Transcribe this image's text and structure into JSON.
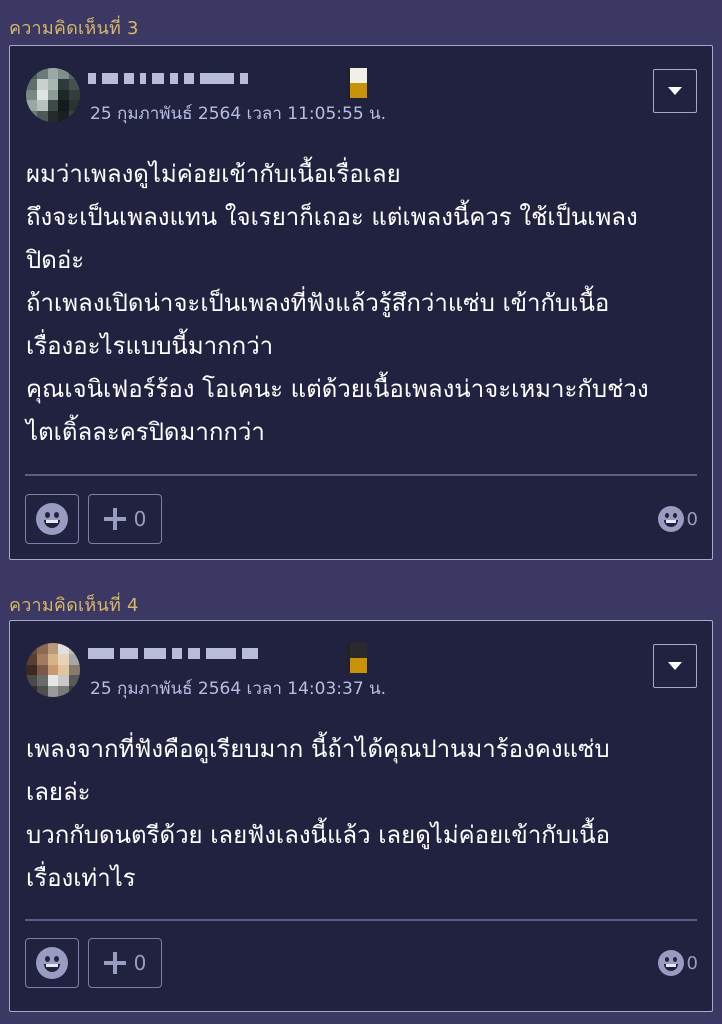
{
  "comments": [
    {
      "label": "ความคิดเห็นที่ 3",
      "timestamp": "25 กุมภาพันธ์ 2564 เวลา 11:05:55 น.",
      "body": "ผมว่าเพลงดูไม่ค่อยเข้ากับเนื้อเรื่อเลย\nถึงจะเป็นเพลงแทน ใจเรยาก็เถอะ แต่เพลงนี้ควร ใช้เป็นเพลง\nปิดอ่ะ\nถ้าเพลงเปิดน่าจะเป็นเพลงที่ฟังแล้วรู้สึกว่าแซ่บ เข้ากับเนื้อ\nเรื่องอะไรแบบนี้มากกว่า\nคุณเจนิเฟอร์ร้อง โอเคนะ แต่ด้วยเนื้อเพลงน่าจะเหมาะกับช่วง\nไตเติ้ลละครปิดมากกว่า",
      "plus_count": "0",
      "emotion_count": "0"
    },
    {
      "label": "ความคิดเห็นที่ 4",
      "timestamp": "25 กุมภาพันธ์ 2564 เวลา 14:03:37 น.",
      "body": "เพลงจากที่ฟังคือดูเรียบมาก นี้ถ้าได้คุณปานมาร้องคงแซ่บ\nเลยล่ะ\nบวกกับดนตรีด้วย เลยฟังเลงนี้แล้ว เลยดูไม่ค่อยเข้ากับเนื้อ\nเรื่องเท่าไร",
      "plus_count": "0",
      "emotion_count": "0"
    }
  ],
  "icons": {
    "menu": "chevron-down-icon",
    "emotion": "smiley-icon",
    "plus": "plus-icon"
  },
  "colors": {
    "page_bg": "#3b3963",
    "card_bg": "#21223f",
    "label": "#d6b56c",
    "timestamp": "#b8bde3",
    "text": "#ffffff"
  }
}
